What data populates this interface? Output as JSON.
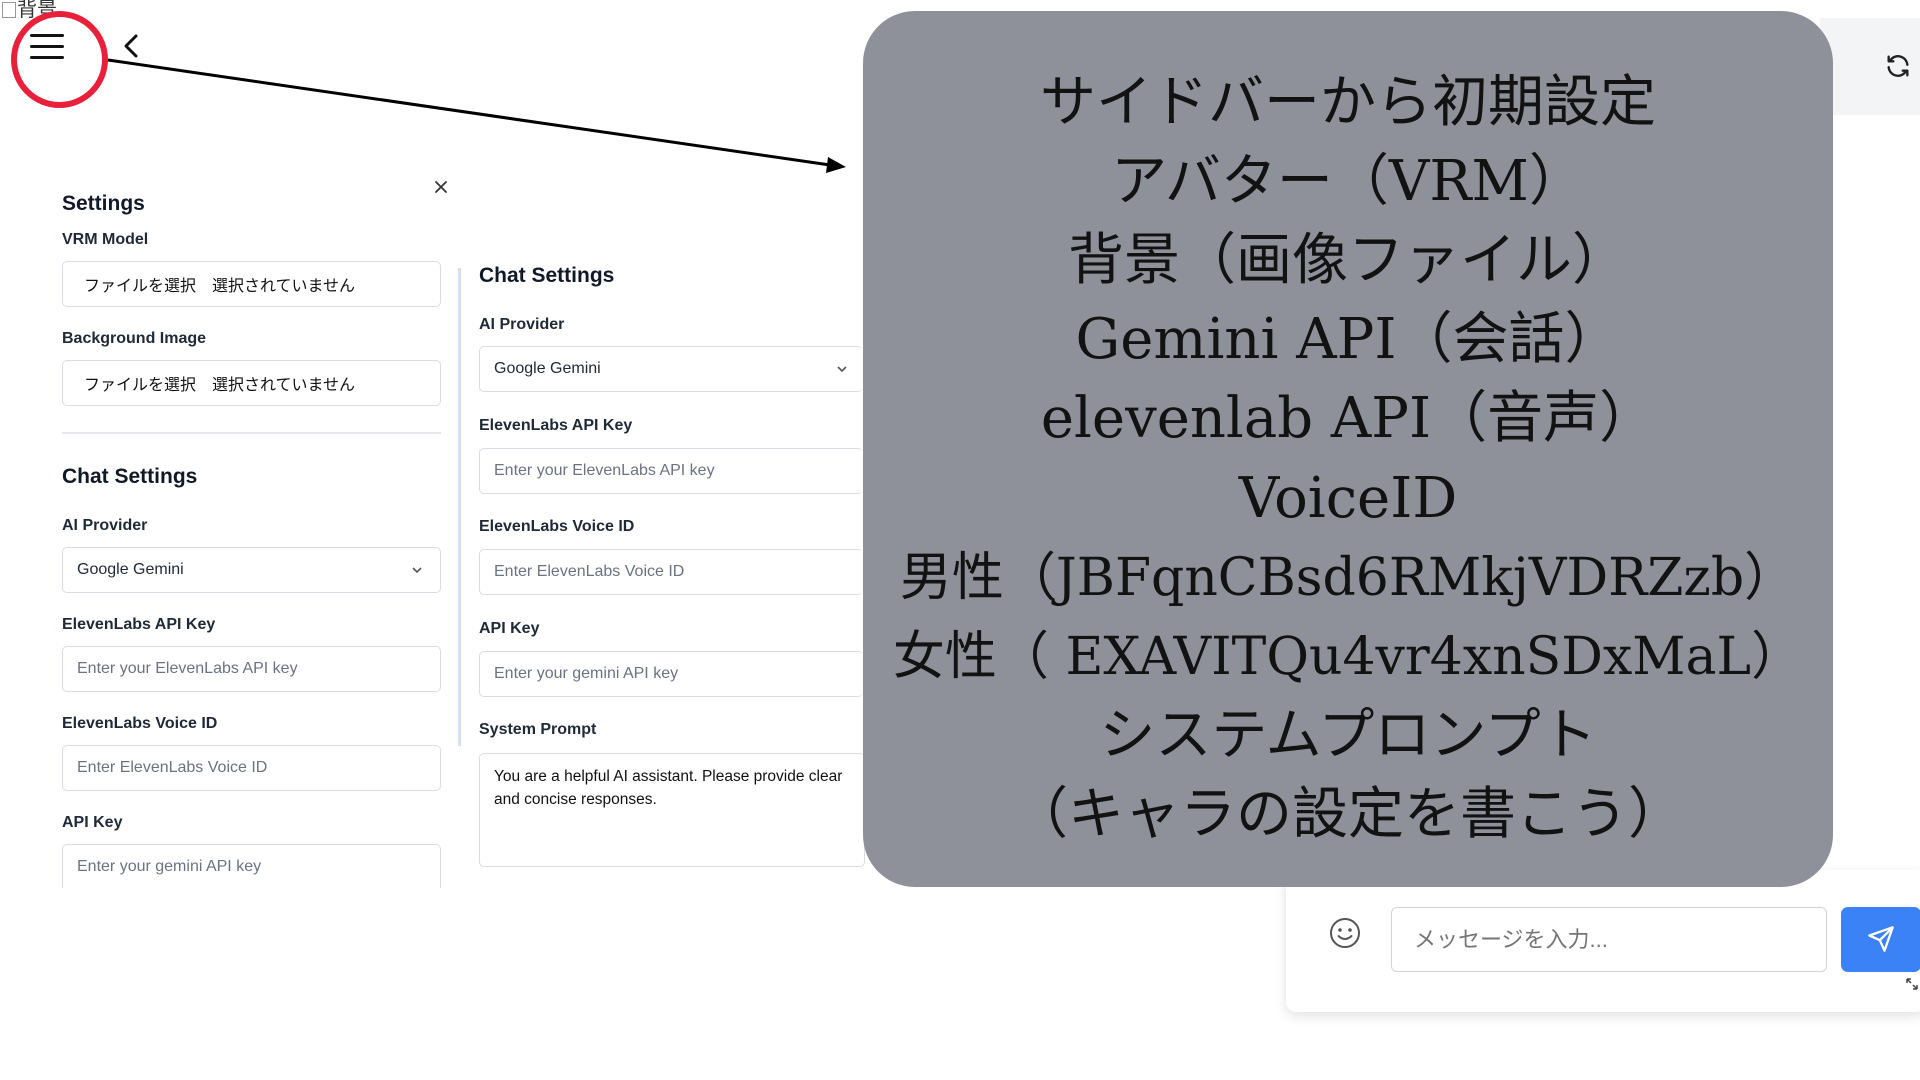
{
  "background": {
    "alt_text": "背景"
  },
  "settings": {
    "title": "Settings",
    "vrm_label": "VRM Model",
    "vrm_file": "ファイルを選択　選択されていません",
    "bg_label": "Background Image",
    "bg_file": "ファイルを選択　選択されていません"
  },
  "chat_settings": {
    "title": "Chat Settings",
    "provider_label": "AI Provider",
    "provider_value": "Google Gemini",
    "el_key_label": "ElevenLabs API Key",
    "el_key_placeholder": "Enter your ElevenLabs API key",
    "voice_label": "ElevenLabs Voice ID",
    "voice_placeholder": "Enter ElevenLabs Voice ID",
    "api_label": "API Key",
    "api_placeholder": "Enter your gemini API key",
    "prompt_label": "System Prompt",
    "prompt_value": "You are a helpful AI assistant. Please provide clear and concise responses."
  },
  "chat": {
    "input_placeholder": "メッセージを入力..."
  },
  "overlay": {
    "lines": [
      "サイドバーから初期設定",
      "アバター（VRM）",
      "背景（画像ファイル）",
      "Gemini API（会話）",
      "elevenlab API（音声）",
      "VoiceID",
      "男性（JBFqnCBsd6RMkjVDRZzb）",
      "女性（ EXAVITQu4vr4xnSDxMaL）",
      "システムプロンプト",
      "（キャラの設定を書こう）"
    ]
  },
  "colors": {
    "annotation_ring": "#e8203a",
    "overlay_bg": "#8e9199",
    "send_button": "#3b82f6"
  },
  "icons": [
    "menu-icon",
    "chevron-left-icon",
    "close-icon",
    "chevron-down-icon",
    "refresh-icon",
    "smile-icon",
    "send-icon",
    "resize-icon"
  ]
}
